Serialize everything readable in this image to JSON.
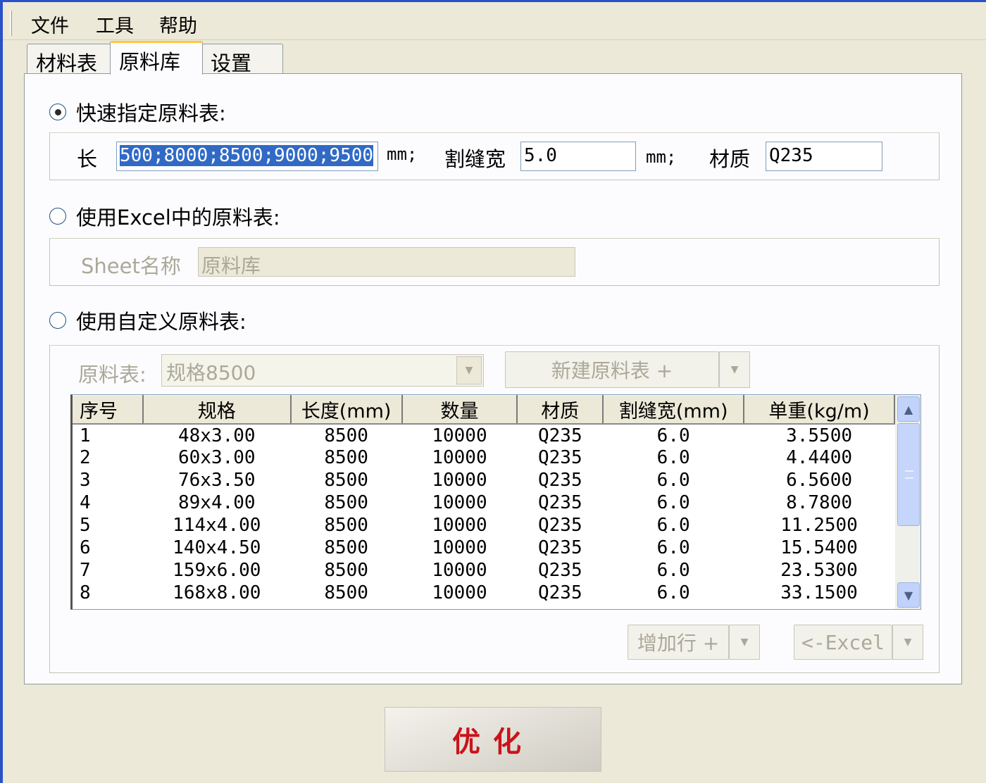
{
  "menu": {
    "items": [
      "文件",
      "工具",
      "帮助"
    ]
  },
  "tabs": [
    "材料表",
    "原料库",
    "设置"
  ],
  "active_tab": "原料库",
  "quick": {
    "radio_label": "快速指定原料表:",
    "length_label": "长",
    "length_value": "500;8000;8500;9000;9500",
    "unit1": "mm;",
    "kerf_label": "割缝宽",
    "kerf_value": "5.0",
    "unit2": "mm;",
    "material_label": "材质",
    "material_value": "Q235"
  },
  "excel": {
    "radio_label": "使用Excel中的原料表:",
    "sheet_label": "Sheet名称",
    "sheet_value": "原料库"
  },
  "custom": {
    "radio_label": "使用自定义原料表:",
    "table_label": "原料表:",
    "table_value": "规格8500",
    "new_button": "新建原料表 +",
    "add_row_button": "增加行 +",
    "excel_button": "<-Excel"
  },
  "grid": {
    "columns": [
      "序号",
      "规格",
      "长度(mm)",
      "数量",
      "材质",
      "割缝宽(mm)",
      "单重(kg/m)"
    ],
    "rows": [
      [
        "1",
        "48x3.00",
        "8500",
        "10000",
        "Q235",
        "6.0",
        "3.5500"
      ],
      [
        "2",
        "60x3.00",
        "8500",
        "10000",
        "Q235",
        "6.0",
        "4.4400"
      ],
      [
        "3",
        "76x3.50",
        "8500",
        "10000",
        "Q235",
        "6.0",
        "6.5600"
      ],
      [
        "4",
        "89x4.00",
        "8500",
        "10000",
        "Q235",
        "6.0",
        "8.7800"
      ],
      [
        "5",
        "114x4.00",
        "8500",
        "10000",
        "Q235",
        "6.0",
        "11.2500"
      ],
      [
        "6",
        "140x4.50",
        "8500",
        "10000",
        "Q235",
        "6.0",
        "15.5400"
      ],
      [
        "7",
        "159x6.00",
        "8500",
        "10000",
        "Q235",
        "6.0",
        "23.5300"
      ],
      [
        "8",
        "168x8.00",
        "8500",
        "10000",
        "Q235",
        "6.0",
        "33.1500"
      ]
    ]
  },
  "optimize_button": "优化",
  "colors": {
    "accent_text": "#c8141a",
    "selection": "#316ac5",
    "tab_highlight": "#ffc83c"
  },
  "icons": {
    "scroll_up": "chevron-up-icon",
    "scroll_down": "chevron-down-icon",
    "dropdown": "triangle-down-icon"
  }
}
